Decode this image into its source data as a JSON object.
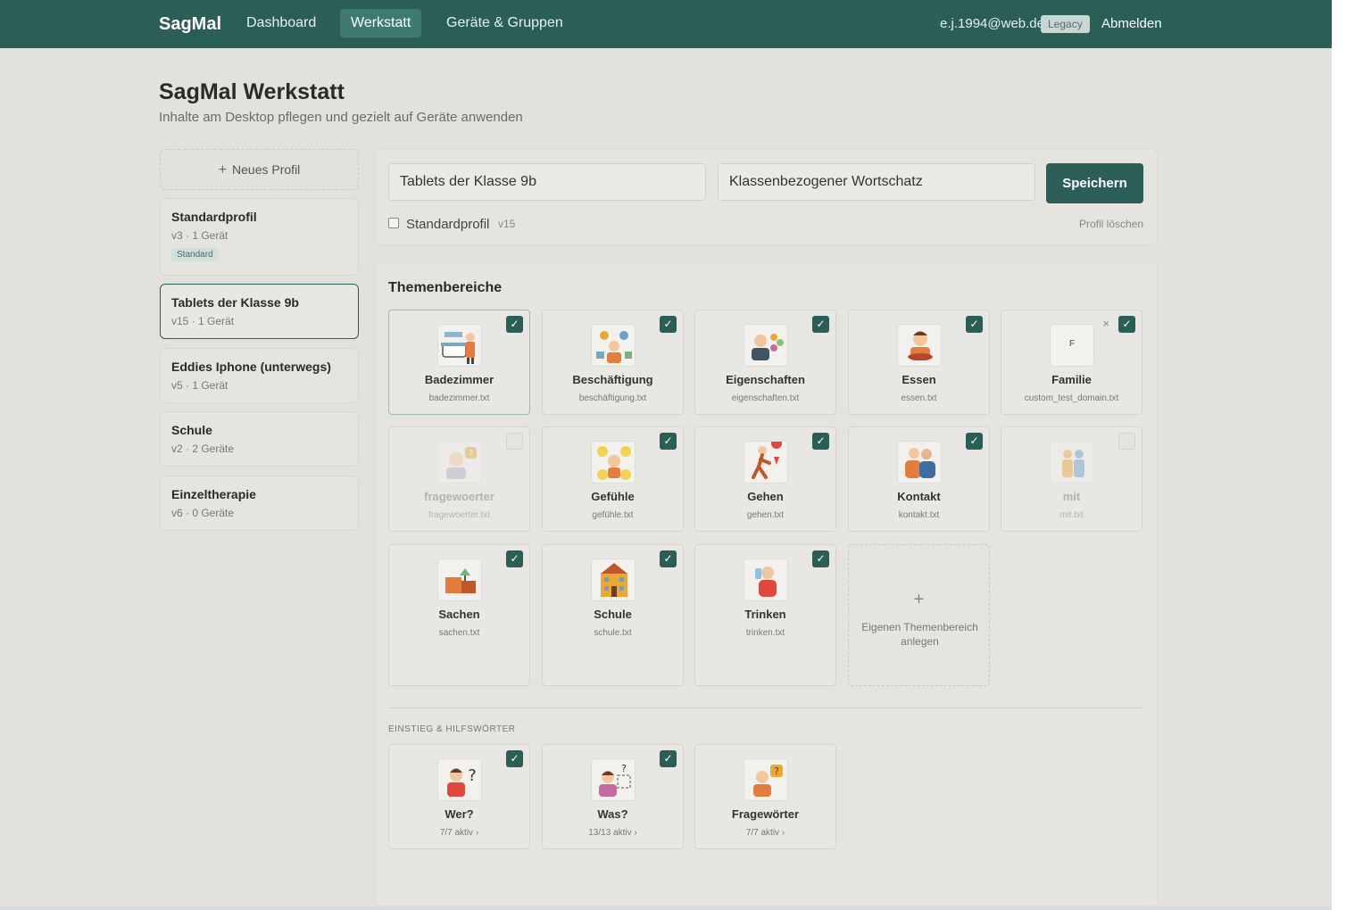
{
  "nav": {
    "brand": "SagMal",
    "items": [
      {
        "label": "Dashboard",
        "active": false
      },
      {
        "label": "Werkstatt",
        "active": true
      },
      {
        "label": "Geräte & Gruppen",
        "active": false
      }
    ],
    "user_email": "e.j.1994@web.de",
    "legacy_badge": "Legacy",
    "logout": "Abmelden"
  },
  "header": {
    "title": "SagMal Werkstatt",
    "subtitle": "Inhalte am Desktop pflegen und gezielt auf Geräte anwenden"
  },
  "sidebar": {
    "new_profile": "Neues Profil",
    "profiles": [
      {
        "name": "Standardprofil",
        "meta": "v3 · 1 Gerät",
        "badge": "Standard",
        "active": false
      },
      {
        "name": "Tablets der Klasse 9b",
        "meta": "v15 · 1 Gerät",
        "active": true
      },
      {
        "name": "Eddies Iphone (unterwegs)",
        "meta": "v5 · 1 Gerät",
        "active": false
      },
      {
        "name": "Schule",
        "meta": "v2 · 2 Geräte",
        "active": false
      },
      {
        "name": "Einzeltherapie",
        "meta": "v6 · 0 Geräte",
        "active": false
      }
    ]
  },
  "editor": {
    "name_value": "Tablets der Klasse 9b",
    "description_value": "Klassenbezogener Wortschatz",
    "save_label": "Speichern",
    "default_label": "Standardprofil",
    "default_checked": false,
    "version": "v15",
    "delete_label": "Profil löschen"
  },
  "themes": {
    "title": "Themenbereiche",
    "tiles": [
      {
        "label": "Badezimmer",
        "file": "badezimmer.txt",
        "checked": true,
        "icon": "bathroom-icon"
      },
      {
        "label": "Beschäftigung",
        "file": "beschäftigung.txt",
        "checked": true,
        "icon": "activities-icon"
      },
      {
        "label": "Eigenschaften",
        "file": "eigenschaften.txt",
        "checked": true,
        "icon": "properties-icon"
      },
      {
        "label": "Essen",
        "file": "essen.txt",
        "checked": true,
        "icon": "eating-icon"
      },
      {
        "label": "Familie",
        "file": "custom_test_domain.txt",
        "checked": true,
        "icon": "letter-f-icon",
        "letter": "F"
      },
      {
        "label": "fragewoerter",
        "file": "fragewoerter.txt",
        "checked": false,
        "icon": "question-person-icon"
      },
      {
        "label": "Gefühle",
        "file": "gefühle.txt",
        "checked": true,
        "icon": "feelings-icon"
      },
      {
        "label": "Gehen",
        "file": "gehen.txt",
        "checked": true,
        "icon": "walking-icon"
      },
      {
        "label": "Kontakt",
        "file": "kontakt.txt",
        "checked": true,
        "icon": "contact-icon"
      },
      {
        "label": "mit",
        "file": "mit.txt",
        "checked": false,
        "icon": "together-icon"
      },
      {
        "label": "Sachen",
        "file": "sachen.txt",
        "checked": true,
        "icon": "things-icon"
      },
      {
        "label": "Schule",
        "file": "schule.txt",
        "checked": true,
        "icon": "school-icon"
      },
      {
        "label": "Trinken",
        "file": "trinken.txt",
        "checked": true,
        "icon": "drinking-icon"
      }
    ],
    "add_label": "Eigenen Themenbereich anlegen",
    "add_symbol": "+",
    "check_symbol": "✓",
    "remove_symbol": "×"
  },
  "helpers": {
    "title": "EINSTIEG & HILFSWÖRTER",
    "tiles": [
      {
        "label": "Wer?",
        "status": "7/7 aktiv ›",
        "checked": true,
        "icon": "who-icon"
      },
      {
        "label": "Was?",
        "status": "13/13 aktiv ›",
        "checked": true,
        "icon": "what-icon"
      },
      {
        "label": "Fragewörter",
        "status": "7/7 aktiv ›",
        "checked": false,
        "icon": "question-words-icon"
      }
    ]
  }
}
